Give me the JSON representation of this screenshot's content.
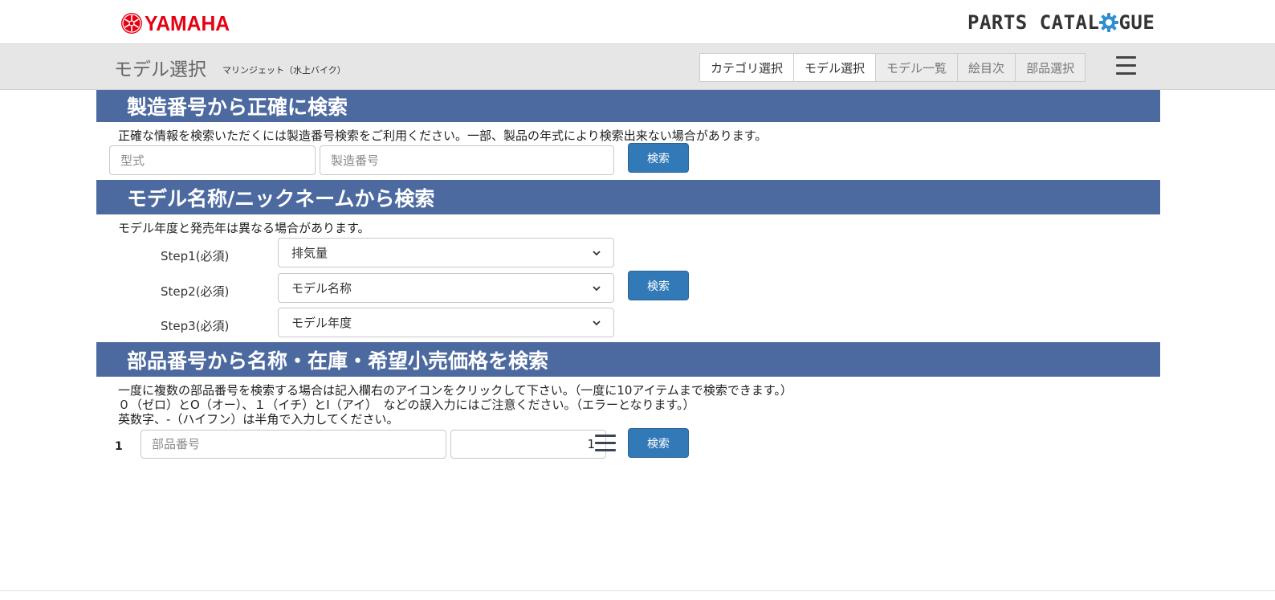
{
  "header": {
    "brand": "YAMAHA",
    "catalogue_prefix": "PARTS CATAL",
    "catalogue_suffix": "GUE",
    "colors": {
      "brand": "#e60012",
      "section": "#4d6aa0",
      "button": "#3279b7"
    }
  },
  "subheader": {
    "title": "モデル選択",
    "subtitle": "マリンジェット（水上バイク）",
    "tabs": [
      {
        "label": "カテゴリ選択",
        "state": "enabled"
      },
      {
        "label": "モデル選択",
        "state": "active"
      },
      {
        "label": "モデル一覧",
        "state": "disabled"
      },
      {
        "label": "絵目次",
        "state": "disabled"
      },
      {
        "label": "部品選択",
        "state": "disabled"
      }
    ],
    "menu_icon": "hamburger-menu-icon"
  },
  "serial_search": {
    "heading": "製造番号から正確に検索",
    "description": "正確な情報を検索いただくには製造番号検索をご利用ください。一部、製品の年式により検索出来ない場合があります。",
    "model_placeholder": "型式",
    "serial_placeholder": "製造番号",
    "button_label": "検索"
  },
  "model_search": {
    "heading": "モデル名称/ニックネームから検索",
    "description": "モデル年度と発売年は異なる場合があります。",
    "steps": [
      {
        "label": "Step1(必須)",
        "selected": "排気量"
      },
      {
        "label": "Step2(必須)",
        "selected": "モデル名称"
      },
      {
        "label": "Step3(必須)",
        "selected": "モデル年度"
      }
    ],
    "button_label": "検索"
  },
  "part_search": {
    "heading": "部品番号から名称・在庫・希望小売価格を検索",
    "notes": [
      "一度に複数の部品番号を検索する場合は記入欄右のアイコンをクリックして下さい。（一度に10アイテムまで検索できます。）",
      "０（ゼロ）とO（オー）、１（イチ）とI（アイ）　などの誤入力にはご注意ください。（エラーとなります。）",
      "英数字、-（ハイフン）は半角で入力してください。"
    ],
    "row_number": "1",
    "part_placeholder": "部品番号",
    "quantity_value": "1",
    "button_label": "検索"
  }
}
